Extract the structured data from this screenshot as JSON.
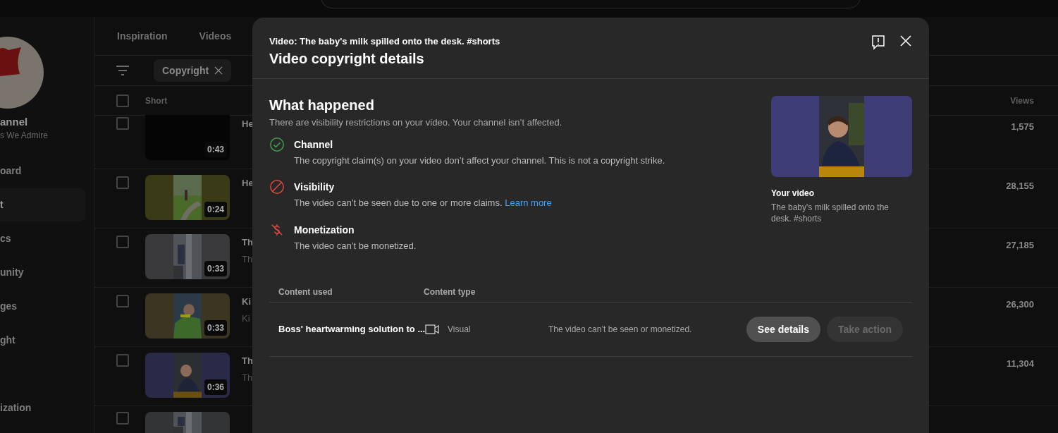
{
  "sidebar": {
    "channel_name": "annel",
    "channel_sub": "s We Admire",
    "items": [
      {
        "label": "oard",
        "selected": false
      },
      {
        "label": "t",
        "selected": true
      },
      {
        "label": "cs",
        "selected": false
      },
      {
        "label": "unity",
        "selected": false
      },
      {
        "label": "ges",
        "selected": false
      },
      {
        "label": "ght",
        "selected": false
      },
      {
        "label": "ization",
        "selected": false
      }
    ]
  },
  "tabs": [
    {
      "label": "Inspiration",
      "selected": false
    },
    {
      "label": "Videos",
      "selected": false
    }
  ],
  "filter_chip": {
    "label": "Copyright"
  },
  "table": {
    "columns": [
      "Short",
      "Views"
    ],
    "select_all": false,
    "last_row_checked": false,
    "rows": [
      {
        "duration": "0:43",
        "title": "He",
        "subtitle": "",
        "views": "1,575",
        "color": "#050505",
        "checked": false
      },
      {
        "duration": "0:24",
        "title": "He",
        "subtitle": "",
        "views": "28,155",
        "color": "#3a3a16",
        "checked": false
      },
      {
        "duration": "0:33",
        "title": "Th",
        "subtitle": "Th",
        "views": "27,185",
        "color": "#3a3a3c",
        "checked": false
      },
      {
        "duration": "0:33",
        "title": "Ki",
        "subtitle": "Ki",
        "views": "26,300",
        "color": "#3b3521",
        "checked": false
      },
      {
        "duration": "0:36",
        "title": "Th",
        "subtitle": "Th",
        "views": "11,304",
        "color": "#2a2a48",
        "checked": false
      }
    ]
  },
  "dialog": {
    "video_line": "Video: The baby's milk spilled onto the desk. #shorts",
    "title": "Video copyright details",
    "section_title": "What happened",
    "section_text": "There are visibility restrictions on your video. Your channel isn’t affected.",
    "impacts": [
      {
        "kind": "ok",
        "title": "Channel",
        "text": "The copyright claim(s) on your video don’t affect your channel. This is not a copyright strike."
      },
      {
        "kind": "blocked",
        "title": "Visibility",
        "text": "The video can’t be seen due to one or more claims.",
        "link": "Learn more"
      },
      {
        "kind": "demonetized",
        "title": "Monetization",
        "text": "The video can’t be monetized."
      }
    ],
    "preview": {
      "label": "Your video",
      "title": "The baby's milk spilled onto the desk. #shorts"
    },
    "claims_table": {
      "columns": [
        "Content used",
        "Content type"
      ],
      "rows": [
        {
          "content": "Boss' heartwarming solution to ...",
          "type": "Visual",
          "impact": "The video can’t be seen or monetized.",
          "actions": [
            {
              "label": "See details",
              "disabled": false
            },
            {
              "label": "Take action",
              "disabled": true
            }
          ]
        }
      ]
    }
  }
}
